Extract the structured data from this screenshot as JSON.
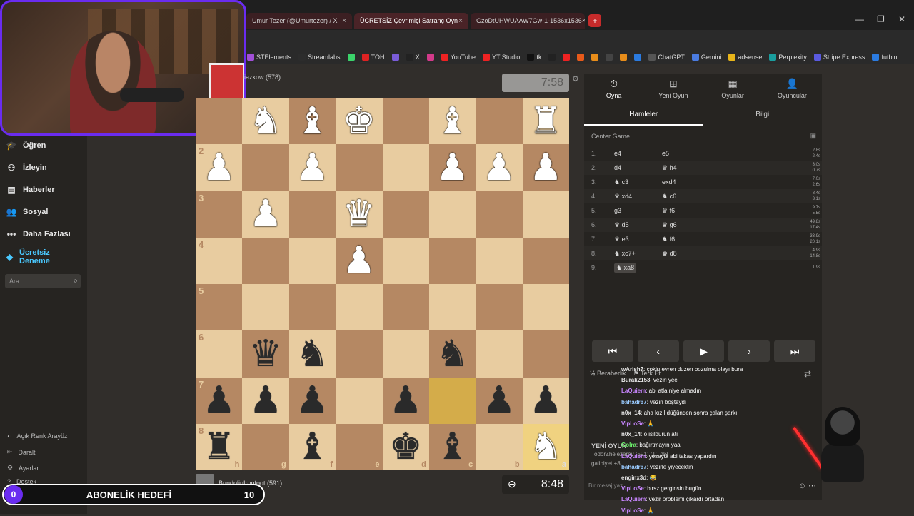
{
  "browser": {
    "tabs": [
      {
        "label": "Umur Tezer (@Umurtezer) / X"
      },
      {
        "label": "ÜCRETSİZ Çevrimiçi Satranç Oyn"
      },
      {
        "label": "GzoDtUHWUAAW7Gw-1-1536x1536"
      }
    ],
    "newtab": "+",
    "bookmarks": [
      {
        "label": "STElements",
        "color": "#a24fd8"
      },
      {
        "label": "Streamlabs",
        "color": "#2c2c2c"
      },
      {
        "label": "",
        "color": "#3bd46b"
      },
      {
        "label": "TÖH",
        "color": "#d22"
      },
      {
        "label": "",
        "color": "#7a5cd8"
      },
      {
        "label": "X",
        "color": "#222"
      },
      {
        "label": "",
        "color": "#d33a8a"
      },
      {
        "label": "YouTube",
        "color": "#e22"
      },
      {
        "label": "YT Studio",
        "color": "#e22"
      },
      {
        "label": "tk",
        "color": "#111"
      },
      {
        "label": "",
        "color": "#222"
      },
      {
        "label": "",
        "color": "#e22"
      },
      {
        "label": "",
        "color": "#e85a1a"
      },
      {
        "label": "",
        "color": "#e88d1a"
      },
      {
        "label": "",
        "color": "#444"
      },
      {
        "label": "",
        "color": "#e88d1a"
      },
      {
        "label": "",
        "color": "#2b7be0"
      },
      {
        "label": "ChatGPT",
        "color": "#555"
      },
      {
        "label": "Gemini",
        "color": "#4a7be0"
      },
      {
        "label": "adsense",
        "color": "#e8b51a"
      },
      {
        "label": "Perplexity",
        "color": "#1a9e9e"
      },
      {
        "label": "Stripe Express",
        "color": "#5a5ae0"
      },
      {
        "label": "futbin",
        "color": "#2b7be0"
      }
    ]
  },
  "leftnav": {
    "items": [
      {
        "label": "Öğren",
        "icon": "graduation-icon"
      },
      {
        "label": "İzleyin",
        "icon": "binoculars-icon"
      },
      {
        "label": "Haberler",
        "icon": "news-icon"
      },
      {
        "label": "Sosyal",
        "icon": "people-icon"
      },
      {
        "label": "Daha Fazlası",
        "icon": "more-icon"
      },
      {
        "label": "Ücretsiz Deneme",
        "icon": "diamond-icon"
      }
    ],
    "search_placeholder": "Ara",
    "bottom": [
      {
        "label": "Açık Renk Arayüz",
        "icon": "contrast-icon"
      },
      {
        "label": "Daralt",
        "icon": "collapse-icon"
      },
      {
        "label": "Ayarlar",
        "icon": "gear-icon"
      },
      {
        "label": "Destek",
        "icon": "help-icon"
      }
    ]
  },
  "game": {
    "top_player": "liazkow (578)",
    "top_clock": "7:58",
    "bottom_player": "BundolinIronfoot (591)",
    "bottom_clock": "8:48",
    "board": [
      [
        "",
        "♞w",
        "♝w",
        "♚w",
        "",
        "♝w",
        "",
        "♜w"
      ],
      [
        "♟w",
        "",
        "♟w",
        "",
        "",
        "♟w",
        "♟w",
        "♟w"
      ],
      [
        "",
        "♟w",
        "",
        "♛w",
        "",
        "",
        "",
        ""
      ],
      [
        "",
        "",
        "",
        "♟w",
        "",
        "",
        "",
        ""
      ],
      [
        "",
        "",
        "",
        "",
        "",
        "",
        "",
        ""
      ],
      [
        "",
        "♛b",
        "♞b",
        "",
        "",
        "♞b",
        "",
        ""
      ],
      [
        "♟b",
        "♟b",
        "♟b",
        "",
        "♟b",
        "",
        "♟b",
        "♟b"
      ],
      [
        "♜b",
        "",
        "♝b",
        "",
        "♚b",
        "♝b",
        "",
        "♞w"
      ]
    ],
    "ranks": [
      "",
      "2",
      "3",
      "4",
      "5",
      "6",
      "7",
      "8"
    ],
    "files": [
      "h",
      "g",
      "f",
      "e",
      "d",
      "c",
      "b",
      "a"
    ]
  },
  "panel": {
    "tabs": [
      {
        "label": "Oyna",
        "icon": "stopwatch-icon"
      },
      {
        "label": "Yeni Oyun",
        "icon": "plus-icon"
      },
      {
        "label": "Oyunlar",
        "icon": "board-icon"
      },
      {
        "label": "Oyuncular",
        "icon": "players-icon"
      }
    ],
    "subtabs": [
      "Hamleler",
      "Bilgi"
    ],
    "opening": "Center Game",
    "moves": [
      {
        "n": "1.",
        "w": "e4",
        "b": "e5",
        "t1": "2.8s",
        "t2": "2.4s"
      },
      {
        "n": "2.",
        "w": "d4",
        "b": "♛ h4",
        "t1": "3.0s",
        "t2": "0.7s"
      },
      {
        "n": "3.",
        "w": "♞ c3",
        "b": "exd4",
        "t1": "7.0s",
        "t2": "2.6s"
      },
      {
        "n": "4.",
        "w": "♛ xd4",
        "b": "♞ c6",
        "t1": "8.4s",
        "t2": "3.1s"
      },
      {
        "n": "5.",
        "w": "g3",
        "b": "♛ f6",
        "t1": "9.7s",
        "t2": "5.5s"
      },
      {
        "n": "6.",
        "w": "♛ d5",
        "b": "♛ g6",
        "t1": "49.8s",
        "t2": "17.4s"
      },
      {
        "n": "7.",
        "w": "♛ e3",
        "b": "♞ f6",
        "t1": "33.9s",
        "t2": "20.1s"
      },
      {
        "n": "8.",
        "w": "♞ xc7+",
        "b": "♚ d8",
        "t1": "4.9s",
        "t2": "14.8s"
      },
      {
        "n": "9.",
        "w": "♞ xa8",
        "b": "",
        "t1": "1.9s",
        "t2": ""
      }
    ],
    "controls": [
      "⏮",
      "‹",
      "▶",
      "›",
      "⏭"
    ],
    "draw": "Beraberlik",
    "resign": "Terk Et",
    "newgame_title": "YENİ OYUN",
    "newgame_line": "TodorZhelezarov (591) (10 dk)",
    "newgame_line2": "galibiyet +8",
    "msg_placeholder": "Bir mesaj yaz..."
  },
  "chat": [
    {
      "user": "wArish7",
      "color": "#e6e6e6",
      "text": ": çoklu evren duzen bozulma olayı bura"
    },
    {
      "user": "Burak2153",
      "color": "#e6e6e6",
      "text": ": veziri yee"
    },
    {
      "user": "LaQuiem",
      "color": "#c886ff",
      "text": ": abi atla niye almadın"
    },
    {
      "user": "bahadr67",
      "color": "#9acbff",
      "text": ": veziri boştaydı"
    },
    {
      "user": "n0x_14",
      "color": "#e6e6e6",
      "text": ": aha kızıl düğünden sonra çalan şarkı"
    },
    {
      "user": "VipLoSe",
      "color": "#c886ff",
      "text": ": 🙏"
    },
    {
      "user": "n0x_14",
      "color": "#e6e6e6",
      "text": ": o isildurun atı"
    },
    {
      "user": "Golra",
      "color": "#6cf06c",
      "text": ": bağırtmayın yaa"
    },
    {
      "user": "LaQuiem",
      "color": "#c886ff",
      "text": ": yeseydi abi takas yapardın"
    },
    {
      "user": "bahadr67",
      "color": "#9acbff",
      "text": ": vezirle yiyecektin"
    },
    {
      "user": "enginx3d",
      "color": "#e6e6e6",
      "text": ": 😂"
    },
    {
      "user": "VipLoSe",
      "color": "#c886ff",
      "text": ": birsz gerginsin bugün"
    },
    {
      "user": "LaQuiem",
      "color": "#c886ff",
      "text": ": vezir problemi çıkardı ortadan"
    },
    {
      "user": "VipLoSe",
      "color": "#c886ff",
      "text": ": 🙏"
    }
  ],
  "subgoal": {
    "left": "0",
    "title": "ABONELİK HEDEFİ",
    "right": "10"
  },
  "colors": {
    "accent": "#6a2cf0",
    "chess_light": "#e8cca0",
    "chess_dark": "#b58863",
    "highlight": "#d4ac4a"
  }
}
